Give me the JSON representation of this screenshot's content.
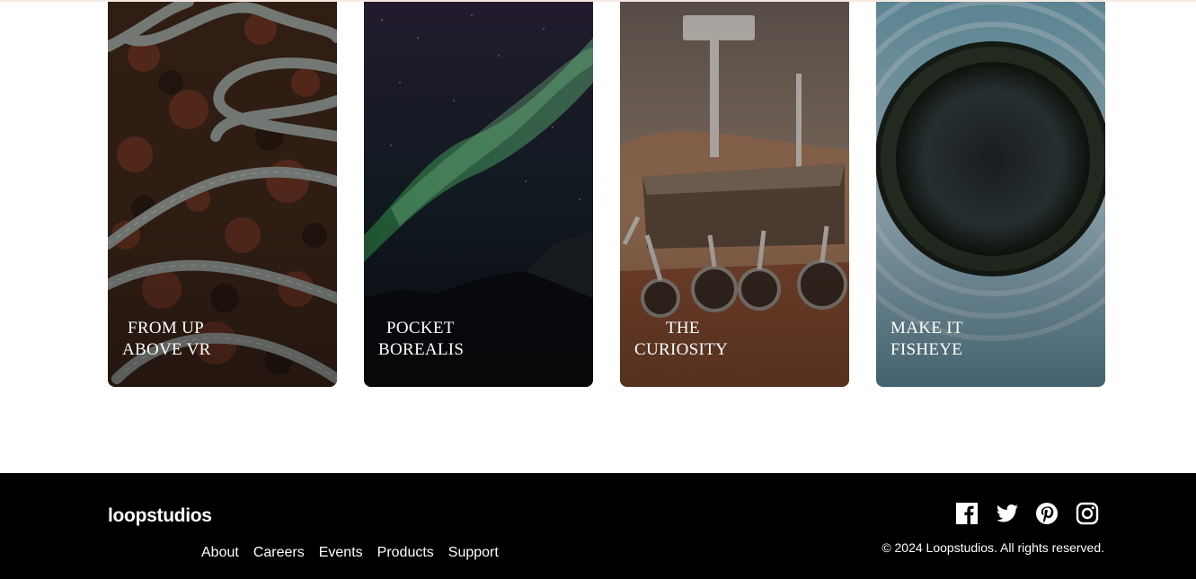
{
  "cards": [
    {
      "title": "FROM UP\nABOVE VR"
    },
    {
      "title": "POCKET\nBOREALIS"
    },
    {
      "title": "THE\nCURIOSITY"
    },
    {
      "title": "MAKE IT\nFISHEYE"
    }
  ],
  "footer": {
    "logo": "loopstudios",
    "nav": [
      "About",
      "Careers",
      "Events",
      "Products",
      "Support"
    ],
    "social_icons": [
      "facebook-icon",
      "twitter-icon",
      "pinterest-icon",
      "instagram-icon"
    ],
    "copyright": "© 2024 Loopstudios. All rights reserved."
  }
}
